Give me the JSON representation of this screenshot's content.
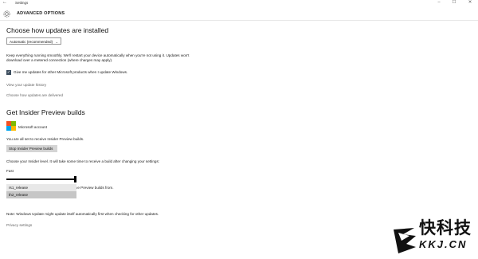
{
  "window": {
    "back_glyph": "←",
    "title": "Settings",
    "controls": [
      "–",
      "☐",
      "✕"
    ]
  },
  "header": {
    "title": "ADVANCED OPTIONS",
    "icon": "gear-icon"
  },
  "updates": {
    "heading": "Choose how updates are installed",
    "dropdown_value": "Automatic (recommended)",
    "description": "Keep everything running smoothly. We'll restart your device automatically when you're not using it. Updates won't download over a metered connection (where charges may apply).",
    "checkbox_checked": true,
    "checkbox_label": "Give me updates for other Microsoft products when I update Windows.",
    "link_history": "View your update history",
    "link_delivered": "Choose how updates are delivered"
  },
  "insider": {
    "heading": "Get Insider Preview builds",
    "account_label": "Microsoft account",
    "ready_text": "You are all set to receive Insider Preview builds.",
    "stop_button": "Stop Insider Preview builds",
    "level_text": "Choose your Insider level. It will take some time to receive a build after changing your settings:",
    "slider_label": "Fast",
    "slider_level": 1.0,
    "partial_text": "ive Preview builds from.",
    "popup_options": [
      "rs1_release",
      "th2_release"
    ],
    "popup_selected": "th2_release"
  },
  "footer": {
    "note": "Note: Windows Update might update itself automatically first when checking for other updates.",
    "privacy_link": "Privacy settings"
  },
  "watermark": {
    "cn_text": "快科技",
    "url_text": "KKJ.CN"
  },
  "colors": {
    "ms_red": "#f25022",
    "ms_green": "#7fba00",
    "ms_blue": "#00a4ef",
    "ms_yellow": "#ffb900",
    "checkbox": "#3c4d5e"
  }
}
